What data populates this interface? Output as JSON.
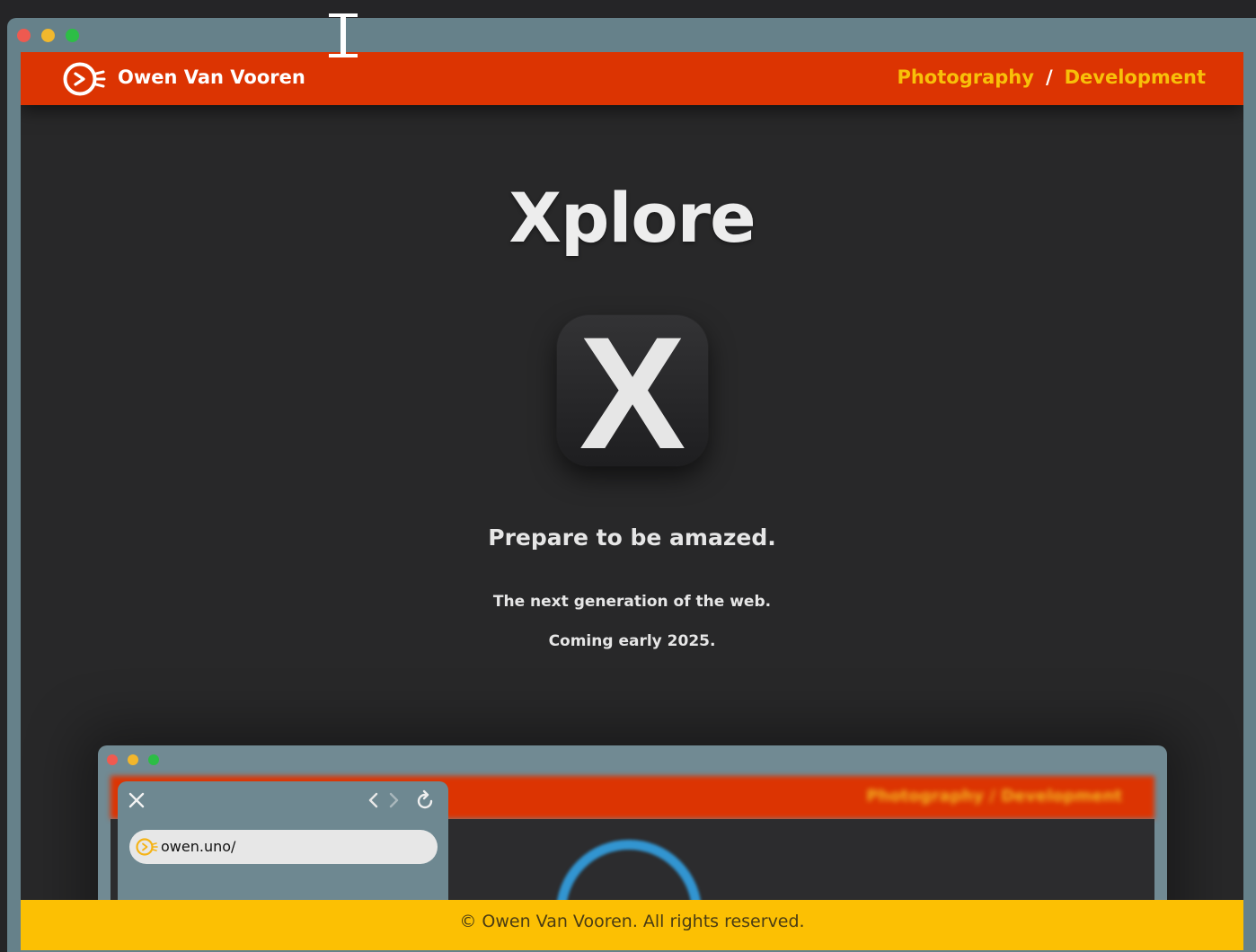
{
  "header": {
    "site_name": "Owen Van Vooren",
    "nav": {
      "photography": "Photography",
      "separator": "/",
      "development": "Development"
    }
  },
  "hero": {
    "title": "Xplore",
    "app_icon_letter": "X",
    "tagline": "Prepare to be amazed.",
    "line1": "The next generation of the web.",
    "line2": "Coming early 2025."
  },
  "preview": {
    "url": "owen.uno/",
    "nav_text": "Photography  /  Development"
  },
  "footer": {
    "copyright": "© Owen Van Vooren. All rights reserved."
  },
  "colors": {
    "header": "#dc3402",
    "nav_link": "#f8c009",
    "footer": "#fcc003",
    "window_frame": "#66818a",
    "page_bg": "#282829"
  },
  "icons": [
    "play-logo-icon",
    "text-cursor-icon",
    "close-icon",
    "chevron-left-icon",
    "chevron-right-icon",
    "reload-icon"
  ]
}
